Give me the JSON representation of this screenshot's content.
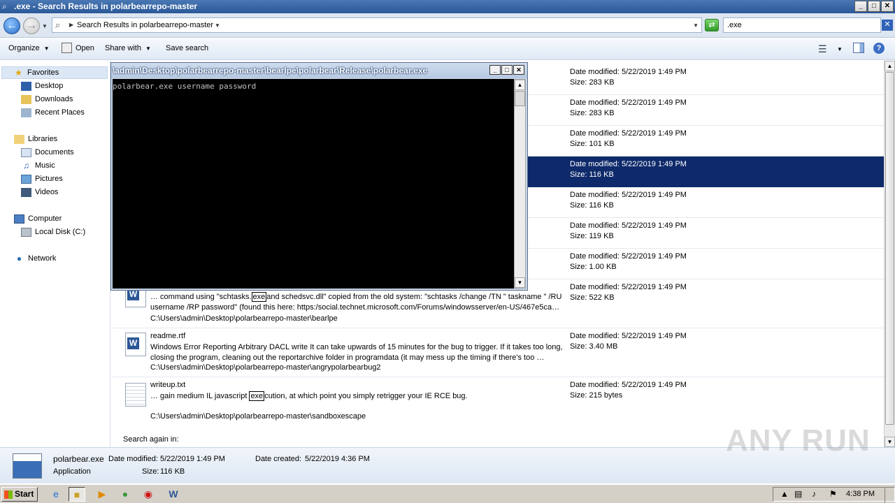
{
  "window": {
    "title": ".exe - Search Results in polarbearrepo-master",
    "buttons": [
      "_",
      "□",
      "✕"
    ]
  },
  "address": {
    "breadcrumb": "Search Results in polarbearrepo-master",
    "search_value": ".exe"
  },
  "toolbar": {
    "organize": "Organize",
    "open": "Open",
    "share_with": "Share with",
    "save_search": "Save search"
  },
  "nav": {
    "favorites": "Favorites",
    "desktop": "Desktop",
    "downloads": "Downloads",
    "recent_places": "Recent Places",
    "libraries": "Libraries",
    "documents": "Documents",
    "music": "Music",
    "pictures": "Pictures",
    "videos": "Videos",
    "computer": "Computer",
    "local_disk": "Local Disk (C:)",
    "network": "Network"
  },
  "results": {
    "rows": [
      {
        "date": "Date modified: 5/22/2019 1:49 PM",
        "size": "Size: 283 KB"
      },
      {
        "date": "Date modified: 5/22/2019 1:49 PM",
        "size": "Size: 283 KB"
      },
      {
        "date": "Date modified: 5/22/2019 1:49 PM",
        "size": "Size: 101 KB"
      },
      {
        "date": "Date modified: 5/22/2019 1:49 PM",
        "size": "Size: 116 KB"
      },
      {
        "date": "Date modified: 5/22/2019 1:49 PM",
        "size": "Size: 116 KB"
      },
      {
        "date": "Date modified: 5/22/2019 1:49 PM",
        "size": "Size: 119 KB"
      },
      {
        "date": "Date modified: 5/22/2019 1:49 PM",
        "size": "Size: 1.00 KB"
      },
      {
        "date": "Date modified: 5/22/2019 1:49 PM",
        "size": "Size: 522 KB",
        "snippet_pre": "… command using \"schtasks.",
        "snippet_hl": "exe",
        "snippet_post": "and schedsvc.dll\" copied from the old system: \"schtasks /change /TN \" taskname \" /RU username /RP password\" (found this here: https:/social.technet.microsoft.com/Forums/windowsserver/en-US/467e5ca…",
        "path": "C:\\Users\\admin\\Desktop\\polarbearrepo-master\\bearlpe"
      },
      {
        "name": "readme.rtf",
        "date": "Date modified: 5/22/2019 1:49 PM",
        "size": "Size: 3.40 MB",
        "snippet": "Windows Error Reporting Arbitrary DACL write It can take upwards of 15 minutes for the bug to trigger. If it takes too long, closing the program, cleaning out the reportarchive folder in programdata (it may mess up the timing if there's too …",
        "path": "C:\\Users\\admin\\Desktop\\polarbearrepo-master\\angrypolarbearbug2"
      },
      {
        "name": "writeup.txt",
        "date": "Date modified: 5/22/2019 1:49 PM",
        "size": "Size: 215 bytes",
        "snippet_pre": "… gain medium IL javascript ",
        "snippet_hl": "exe",
        "snippet_post": "cution, at which point you simply retrigger your IE RCE bug.",
        "path": "C:\\Users\\admin\\Desktop\\polarbearrepo-master\\sandboxescape"
      }
    ],
    "search_again": "Search again in:"
  },
  "console": {
    "title": "\\admin\\Desktop\\polarbearrepo-master\\bearlpe\\polarbear\\Release\\polarbear.exe",
    "output": "polarbear.exe username password"
  },
  "details": {
    "name": "polarbear.exe",
    "type": "Application",
    "date_modified_label": "Date modified:",
    "date_modified": "5/22/2019 1:49 PM",
    "size_label": "Size:",
    "size": "116 KB",
    "date_created_label": "Date created:",
    "date_created": "5/22/2019 4:36 PM"
  },
  "taskbar": {
    "start": "Start",
    "clock": "4:38 PM"
  },
  "watermark": "ANY RUN",
  "colors": {
    "selection": "#0f2a6b",
    "title_bar": "#2a5898",
    "console_bg": "#000000"
  }
}
